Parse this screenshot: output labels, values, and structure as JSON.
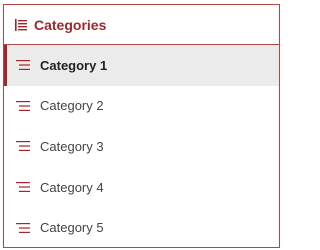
{
  "header": {
    "title": "Categories",
    "icon": "category-list-icon"
  },
  "colors": {
    "accent": "#a3262b",
    "border": "#b0484a",
    "selected_bg": "#ebebeb"
  },
  "items": [
    {
      "label": "Category 1",
      "icon": "category-lines-icon",
      "selected": true
    },
    {
      "label": "Category 2",
      "icon": "category-lines-icon",
      "selected": false
    },
    {
      "label": "Category 3",
      "icon": "category-lines-icon",
      "selected": false
    },
    {
      "label": "Category 4",
      "icon": "category-lines-icon",
      "selected": false
    },
    {
      "label": "Category 5",
      "icon": "category-lines-icon",
      "selected": false
    }
  ]
}
